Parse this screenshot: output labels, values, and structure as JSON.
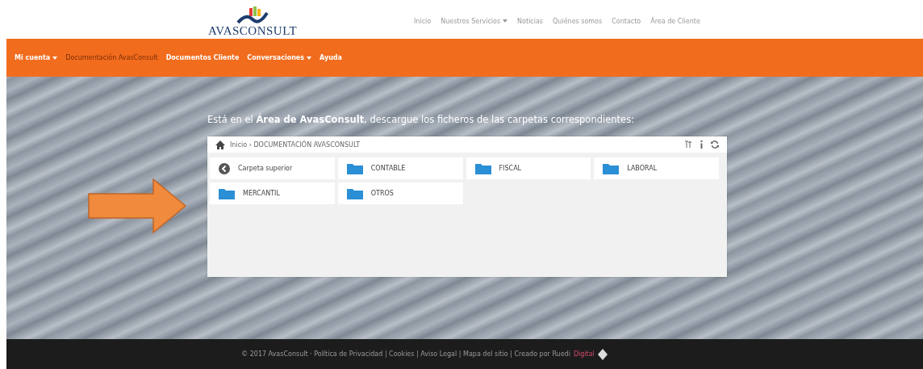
{
  "logo": {
    "text": "AVASCONSULT"
  },
  "top_nav": [
    {
      "label": "Inicio",
      "dropdown": false
    },
    {
      "label": "Nuestros Servicios",
      "dropdown": true
    },
    {
      "label": "Noticias",
      "dropdown": false
    },
    {
      "label": "Quiénes somos",
      "dropdown": false
    },
    {
      "label": "Contacto",
      "dropdown": false
    },
    {
      "label": "Área de Cliente",
      "dropdown": false
    }
  ],
  "sub_nav": [
    {
      "label": "Mi cuenta",
      "dropdown": true,
      "selected": false
    },
    {
      "label": "Documentación AvasConsult",
      "dropdown": false,
      "selected": true
    },
    {
      "label": "Documentos Cliente",
      "dropdown": false,
      "selected": false
    },
    {
      "label": "Conversaciones",
      "dropdown": true,
      "selected": false
    },
    {
      "label": "Ayuda",
      "dropdown": false,
      "selected": false
    }
  ],
  "heading": "Está en el **Área de AvasConsult**, descargue los ficheros de las carpetas correspondientes:",
  "browser": {
    "breadcrumb": "Inicio › DOCUMENTACIÓN AVASCONSULT",
    "items": [
      {
        "kind": "up",
        "label": "Carpeta superior"
      },
      {
        "kind": "folder",
        "label": "CONTABLE"
      },
      {
        "kind": "folder",
        "label": "FISCAL"
      },
      {
        "kind": "folder",
        "label": "LABORAL"
      },
      {
        "kind": "folder",
        "label": "MERCANTIL"
      },
      {
        "kind": "folder",
        "label": "OTROS"
      }
    ]
  },
  "footer": {
    "text": "© 2017 AvasConsult · Política de Privacidad | Cookies | Aviso Legal | Mapa del sitio | Creado por Ruedi",
    "accent": "Digital"
  }
}
